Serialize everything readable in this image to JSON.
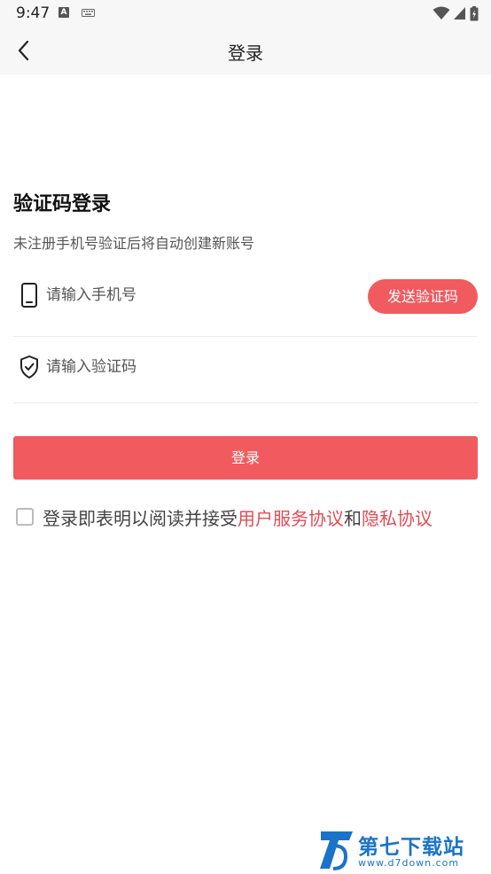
{
  "status_bar": {
    "time": "9:47",
    "a_badge": "A"
  },
  "header": {
    "title": "登录"
  },
  "main": {
    "section_title": "验证码登录",
    "subtitle": "未注册手机号验证后将自动创建新账号",
    "phone": {
      "placeholder": "请输入手机号",
      "value": ""
    },
    "send_code_label": "发送验证码",
    "code": {
      "placeholder": "请输入验证码",
      "value": ""
    },
    "login_label": "登录"
  },
  "agreement": {
    "checked": false,
    "prefix": "登录即表明以阅读并接受",
    "user_agreement": "用户服务协议",
    "conjunction": "和",
    "privacy_agreement": "隐私协议"
  },
  "watermark": {
    "name": "第七下载站",
    "url": "www.d7down.com"
  },
  "colors": {
    "accent": "#f15a5e",
    "link": "#e24c55",
    "header_bg": "#f7f7f7",
    "watermark": "#1a73c9"
  }
}
